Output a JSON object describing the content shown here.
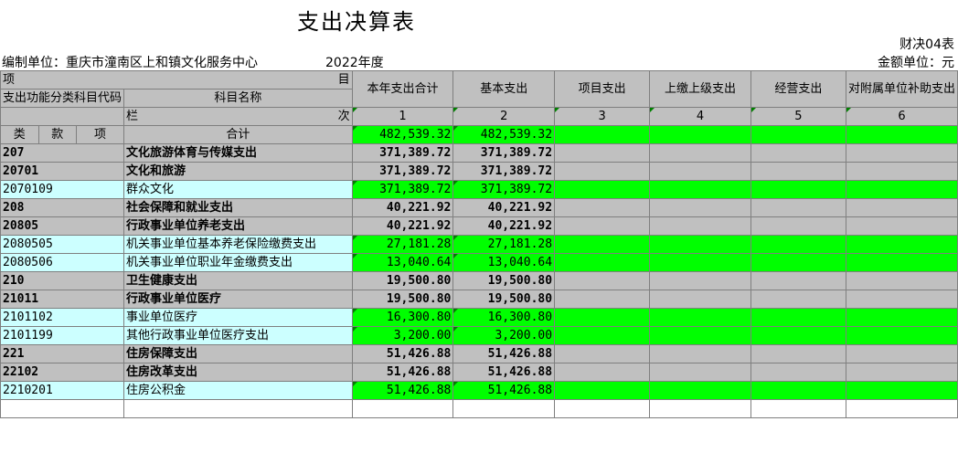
{
  "title": "支出决算表",
  "form_code": "财决04表",
  "unit_label": "编制单位：",
  "unit_name": "重庆市潼南区上和镇文化服务中心",
  "year": "2022年度",
  "amount_unit": "金额单位：元",
  "header": {
    "xiang": "项",
    "mu": "目",
    "code_label": "支出功能分类科目代码",
    "name_label": "科目名称",
    "columns": [
      "本年支出合计",
      "基本支出",
      "项目支出",
      "上缴上级支出",
      "经营支出",
      "对附属单位补助支出"
    ],
    "lan": "栏",
    "ci": "次",
    "lei": "类",
    "kuan": "款",
    "xiang2": "项",
    "col_numbers": [
      "1",
      "2",
      "3",
      "4",
      "5",
      "6"
    ]
  },
  "total": {
    "label": "合计",
    "c1": "482,539.32",
    "c2": "482,539.32"
  },
  "rows": [
    {
      "code": "207",
      "name": "文化旅游体育与传媒支出",
      "c1": "371,389.72",
      "c2": "371,389.72",
      "level": "bold"
    },
    {
      "code": "20701",
      "name": "文化和旅游",
      "c1": "371,389.72",
      "c2": "371,389.72",
      "level": "bold"
    },
    {
      "code": "2070109",
      "name": "群众文化",
      "c1": "371,389.72",
      "c2": "371,389.72",
      "level": "item"
    },
    {
      "code": "208",
      "name": "社会保障和就业支出",
      "c1": "40,221.92",
      "c2": "40,221.92",
      "level": "bold"
    },
    {
      "code": "20805",
      "name": "行政事业单位养老支出",
      "c1": "40,221.92",
      "c2": "40,221.92",
      "level": "bold"
    },
    {
      "code": "2080505",
      "name": "机关事业单位基本养老保险缴费支出",
      "c1": "27,181.28",
      "c2": "27,181.28",
      "level": "item"
    },
    {
      "code": "2080506",
      "name": "机关事业单位职业年金缴费支出",
      "c1": "13,040.64",
      "c2": "13,040.64",
      "level": "item"
    },
    {
      "code": "210",
      "name": "卫生健康支出",
      "c1": "19,500.80",
      "c2": "19,500.80",
      "level": "bold"
    },
    {
      "code": "21011",
      "name": "行政事业单位医疗",
      "c1": "19,500.80",
      "c2": "19,500.80",
      "level": "bold"
    },
    {
      "code": "2101102",
      "name": "事业单位医疗",
      "c1": "16,300.80",
      "c2": "16,300.80",
      "level": "item"
    },
    {
      "code": "2101199",
      "name": "其他行政事业单位医疗支出",
      "c1": "3,200.00",
      "c2": "3,200.00",
      "level": "item"
    },
    {
      "code": "221",
      "name": "住房保障支出",
      "c1": "51,426.88",
      "c2": "51,426.88",
      "level": "bold"
    },
    {
      "code": "22102",
      "name": "住房改革支出",
      "c1": "51,426.88",
      "c2": "51,426.88",
      "level": "bold"
    },
    {
      "code": "2210201",
      "name": "住房公积金",
      "c1": "51,426.88",
      "c2": "51,426.88",
      "level": "item"
    }
  ]
}
